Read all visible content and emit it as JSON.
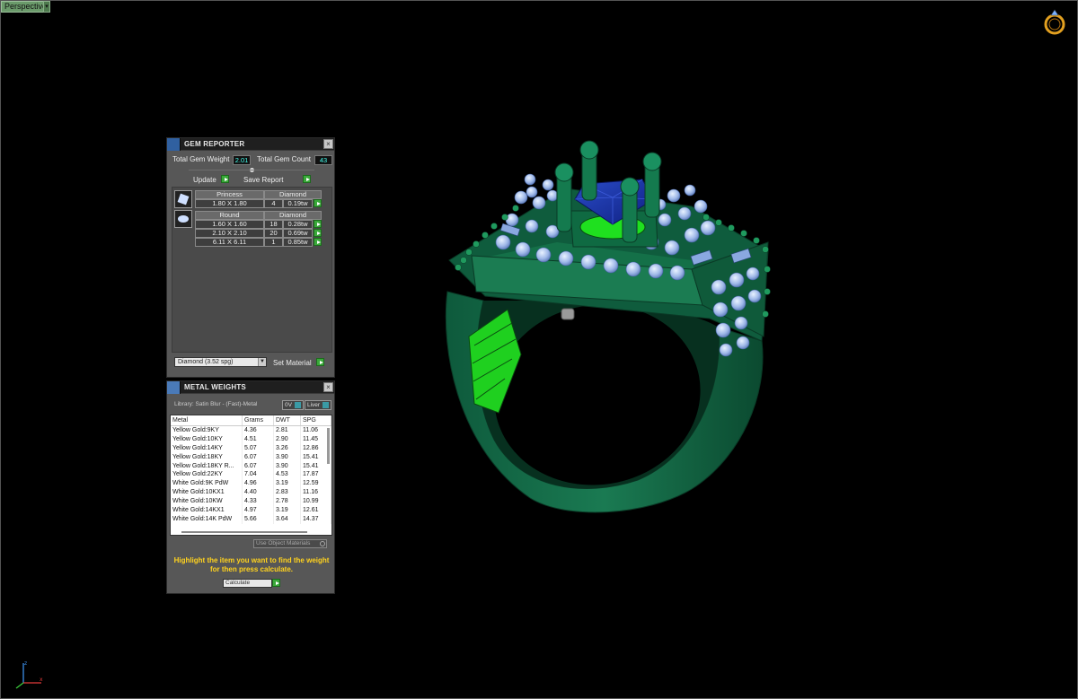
{
  "viewport": {
    "view_label": "Perspective"
  },
  "gem_reporter": {
    "title": "GEM REPORTER",
    "total_weight_label": "Total Gem Weight",
    "total_weight_value": "2.01",
    "total_count_label": "Total Gem Count",
    "total_count_value": "43",
    "update_label": "Update",
    "save_report_label": "Save Report",
    "groups": [
      {
        "shape": "Princess",
        "material": "Diamond",
        "rows": [
          {
            "size": "1.80 X 1.80",
            "count": "4",
            "weight": "0.19tw"
          }
        ]
      },
      {
        "shape": "Round",
        "material": "Diamond",
        "rows": [
          {
            "size": "1.60 X 1.60",
            "count": "18",
            "weight": "0.28tw"
          },
          {
            "size": "2.10 X 2.10",
            "count": "20",
            "weight": "0.69tw"
          },
          {
            "size": "6.11 X 6.11",
            "count": "1",
            "weight": "0.85tw"
          }
        ]
      }
    ],
    "material_select": "Diamond     (3.52 spg)",
    "set_material_label": "Set Material"
  },
  "metal_weights": {
    "title": "METAL WEIGHTS",
    "library_label": "Library: Satin Blur - (Fast)-Metal",
    "ov_label": "0V",
    "liver_label": "Liver",
    "columns": [
      "Metal",
      "Grams",
      "DWT",
      "SPG"
    ],
    "rows": [
      [
        "Yellow Gold:9KY",
        "4.36",
        "2.81",
        "11.06"
      ],
      [
        "Yellow Gold:10KY",
        "4.51",
        "2.90",
        "11.45"
      ],
      [
        "Yellow Gold:14KY",
        "5.07",
        "3.26",
        "12.86"
      ],
      [
        "Yellow Gold:18KY",
        "6.07",
        "3.90",
        "15.41"
      ],
      [
        "Yellow Gold:18KY R...",
        "6.07",
        "3.90",
        "15.41"
      ],
      [
        "Yellow Gold:22KY",
        "7.04",
        "4.53",
        "17.87"
      ],
      [
        "White Gold:9K PdW",
        "4.96",
        "3.19",
        "12.59"
      ],
      [
        "White Gold:10KX1",
        "4.40",
        "2.83",
        "11.16"
      ],
      [
        "White Gold:10KW",
        "4.33",
        "2.78",
        "10.99"
      ],
      [
        "White Gold:14KX1",
        "4.97",
        "3.19",
        "12.61"
      ],
      [
        "White Gold:14K PdW",
        "5.66",
        "3.64",
        "14.37"
      ]
    ],
    "use_object_materials_label": "Use Object Materials",
    "hint": "Highlight the item you want to find the weight for then press calculate.",
    "calculate_label": "Calculate"
  }
}
